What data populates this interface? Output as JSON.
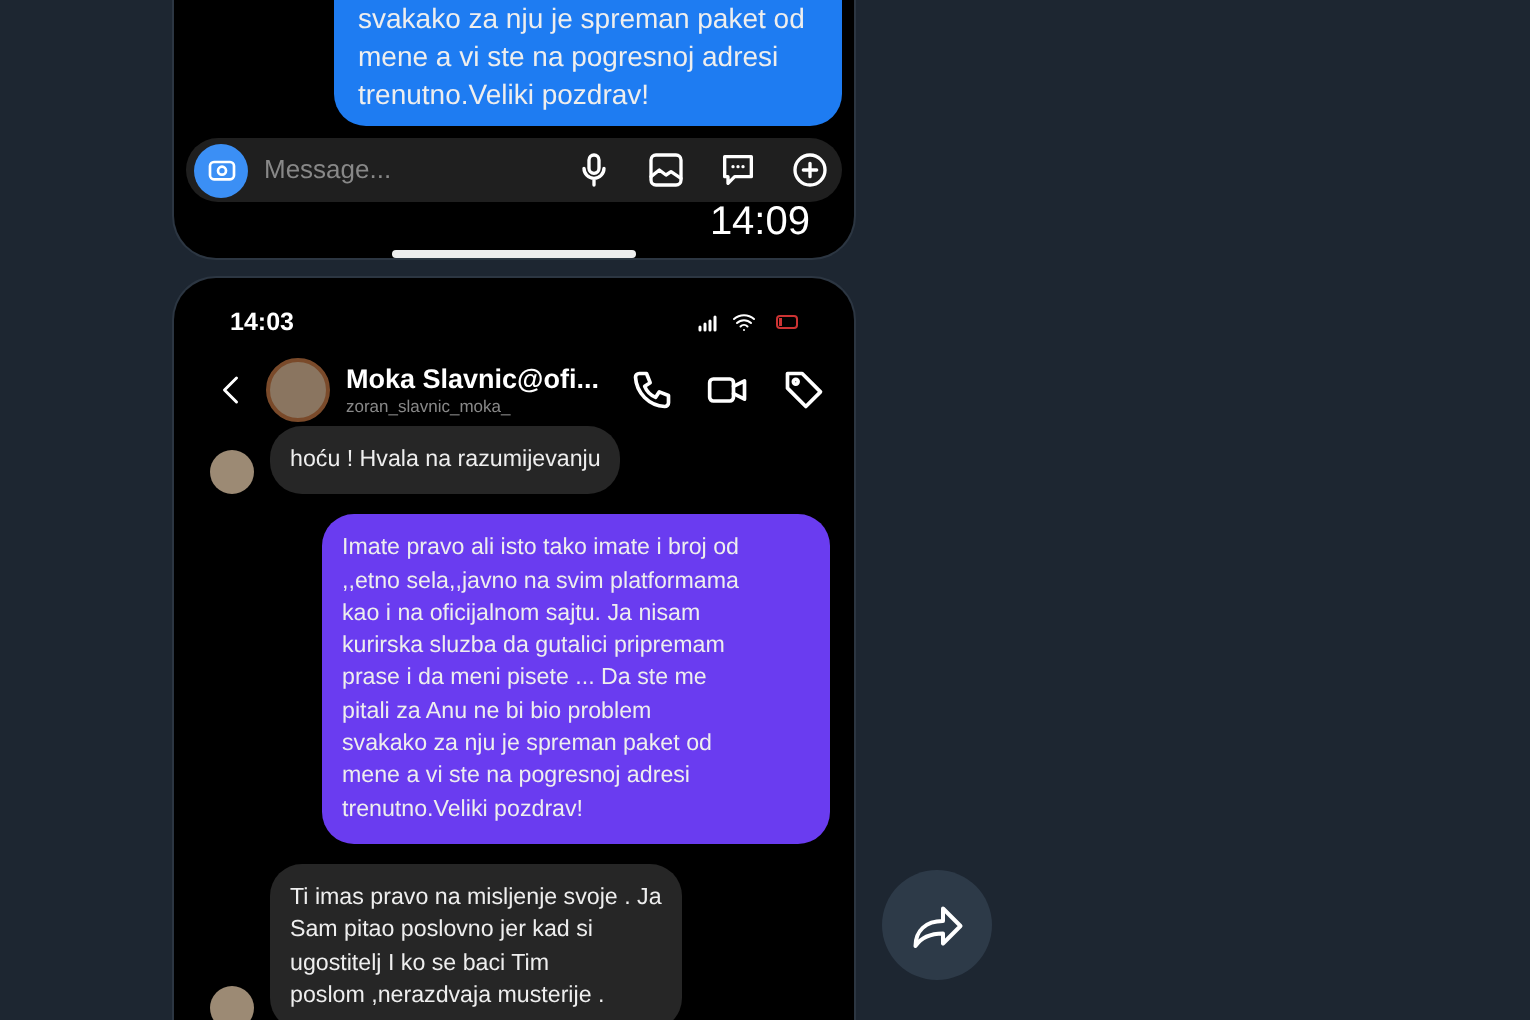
{
  "top_screenshot": {
    "messages": [
      {
        "kind": "outgoing",
        "color": "#1e7cf2",
        "lines": [
          "svakako za nju je spreman paket od",
          "mene a vi ste na pogresnoj adresi",
          "trenutno.Veliki pozdrav!"
        ]
      }
    ],
    "composer": {
      "placeholder": "Message..."
    },
    "time": "14:09"
  },
  "bottom_screenshot": {
    "status_time": "14:03",
    "contact": {
      "name": "Moka Slavnic@ofi...",
      "username": "zoran_slavnic_moka_"
    },
    "messages": [
      {
        "kind": "incoming",
        "color": "#262626",
        "lines": [
          "hoću ! Hvala na razumijevanju"
        ]
      },
      {
        "kind": "outgoing",
        "color": "#6a3cf0",
        "lines": [
          "Imate pravo ali isto tako imate i broj od",
          ",,etno sela,,javno na svim platformama",
          "kao i na oficijalnom sajtu. Ja nisam",
          "kurirska sluzba  da gutalici pripremam",
          "prase i da meni pisete ... Da ste me",
          "pitali za Anu ne bi bio problem",
          "svakako za nju je spreman paket od",
          "mene a vi ste na pogresnoj adresi",
          "trenutno.Veliki pozdrav!"
        ]
      },
      {
        "kind": "incoming",
        "color": "#262626",
        "lines": [
          "Ti imas pravo na misljenje svoje . Ja",
          "Sam pitao poslovno jer kad si",
          "ugostitelj I ko se baci Tim",
          "poslom ,nerazdvaja musterije ."
        ]
      }
    ]
  }
}
